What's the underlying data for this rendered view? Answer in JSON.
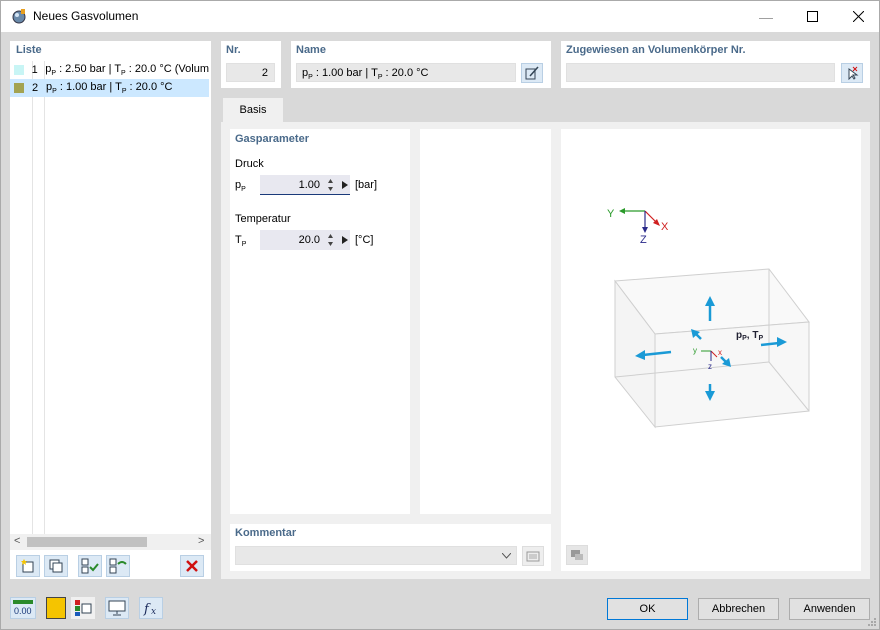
{
  "window": {
    "title": "Neues Gasvolumen",
    "minimize_glyph": "—",
    "maximize_glyph": "☐",
    "close_glyph": "✕"
  },
  "list": {
    "header": "Liste",
    "items": [
      {
        "num": "1",
        "label_pre": "p",
        "label_sub": "P",
        "label_mid": " : 2.50 bar | T",
        "label_sub2": "P",
        "label_post": " : 20.0 °C (Volum",
        "color": "#c8f5f5"
      },
      {
        "num": "2",
        "label_pre": "p",
        "label_sub": "P",
        "label_mid": " : 1.00 bar | T",
        "label_sub2": "P",
        "label_post": " : 20.0 °C",
        "color": "#a3a352"
      }
    ],
    "scroll_left": "<",
    "scroll_right": ">"
  },
  "nr": {
    "label": "Nr.",
    "value": "2"
  },
  "name": {
    "label": "Name",
    "value_pre": "p",
    "value_sub": "P",
    "value_mid": " : 1.00 bar | T",
    "value_sub2": "P",
    "value_post": " : 20.0 °C"
  },
  "assigned": {
    "label": "Zugewiesen an Volumenkörper Nr.",
    "value": ""
  },
  "tabs": [
    {
      "label": "Basis"
    }
  ],
  "gas": {
    "header": "Gasparameter",
    "pressure_label": "Druck",
    "pressure_sym": "p",
    "pressure_sym_sub": "P",
    "pressure_value": "1.00",
    "pressure_unit": "[bar]",
    "temp_label": "Temperatur",
    "temp_sym": "T",
    "temp_sym_sub": "P",
    "temp_value": "20.0",
    "temp_unit": "[°C]"
  },
  "diagram": {
    "axis_y": "Y",
    "axis_x": "X",
    "axis_z": "Z",
    "small_y": "y",
    "small_x": "x",
    "small_z": "z",
    "label_p": "p",
    "label_p_sub": "P",
    "label_sep": ", ",
    "label_t": "T",
    "label_t_sub": "P"
  },
  "comment": {
    "label": "Kommentar",
    "value": ""
  },
  "buttons": {
    "ok": "OK",
    "cancel": "Abbrechen",
    "apply": "Anwenden"
  },
  "icons": {
    "value_icon": "0.00"
  },
  "colors": {
    "accent": "#4a6a8a",
    "arrow": "#1a9ad6",
    "swatch_yellow": "#f5c400"
  }
}
